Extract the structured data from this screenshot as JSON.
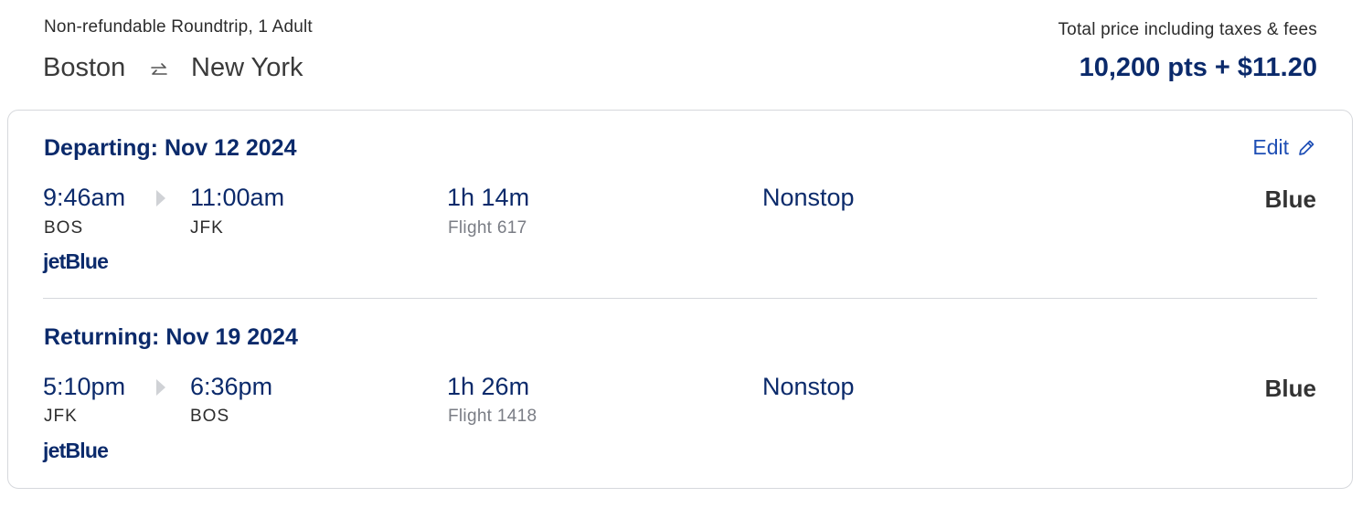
{
  "header": {
    "trip_type": "Non-refundable Roundtrip, 1 Adult",
    "origin": "Boston",
    "destination": "New York",
    "swap_icon": "swap-arrows-icon",
    "price_label": "Total price including taxes & fees",
    "price": "10,200 pts + $11.20"
  },
  "edit": {
    "label": "Edit",
    "icon": "pencil-icon"
  },
  "segments": [
    {
      "title": "Departing: Nov 12 2024",
      "dep_time": "9:46am",
      "dep_code": "BOS",
      "arr_time": "11:00am",
      "arr_code": "JFK",
      "duration": "1h 14m",
      "flight": "Flight 617",
      "stops": "Nonstop",
      "fare": "Blue",
      "airline": "jetBlue"
    },
    {
      "title": "Returning: Nov 19 2024",
      "dep_time": "5:10pm",
      "dep_code": "JFK",
      "arr_time": "6:36pm",
      "arr_code": "BOS",
      "duration": "1h 26m",
      "flight": "Flight 1418",
      "stops": "Nonstop",
      "fare": "Blue",
      "airline": "jetBlue"
    }
  ],
  "colors": {
    "navy": "#0b2a6b",
    "link": "#1f4fb5",
    "muted": "#7a7d85",
    "border": "#d6d8dc"
  }
}
